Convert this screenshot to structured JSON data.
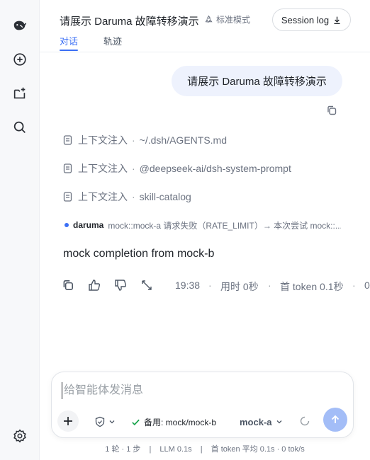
{
  "header": {
    "title": "请展示 Daruma 故障转移演示",
    "mode": "标准模式",
    "session_log": "Session log",
    "tabs": [
      {
        "label": "对话",
        "active": true
      },
      {
        "label": "轨迹",
        "active": false
      }
    ]
  },
  "sidebar": {
    "items": [
      {
        "icon": "whale-logo-icon"
      },
      {
        "icon": "new-chat-icon"
      },
      {
        "icon": "new-folder-icon"
      },
      {
        "icon": "search-icon"
      },
      {
        "icon": "settings-icon"
      }
    ]
  },
  "chat": {
    "user_message": "请展示 Daruma 故障转移演示",
    "context_items": [
      {
        "label": "上下文注入",
        "path": "~/.dsh/AGENTS.md"
      },
      {
        "label": "上下文注入",
        "path": "@deepseek-ai/dsh-system-prompt"
      },
      {
        "label": "上下文注入",
        "path": "skill-catalog"
      }
    ],
    "log": {
      "name": "daruma",
      "text": "mock::mock-a 请求失败（RATE_LIMIT）→ 本次尝试 mock::..."
    },
    "answer": "mock completion from mock-b",
    "meta": {
      "time": "19:38",
      "duration": "用时 0秒",
      "first_token": "首 token 0.1秒",
      "more": "0"
    }
  },
  "composer": {
    "placeholder": "给智能体发消息",
    "fallback": "备用: mock/mock-b",
    "model": "mock-a"
  },
  "footer": {
    "rounds": "1 轮 · 1 步",
    "llm": "LLM 0.1s",
    "token": "首 token 平均 0.1s · 0 tok/s"
  },
  "colors": {
    "accent": "#3b6ff5",
    "user_bubble": "#eef2fd",
    "send_disabled": "#a3bdf7",
    "success": "#16a34a"
  }
}
